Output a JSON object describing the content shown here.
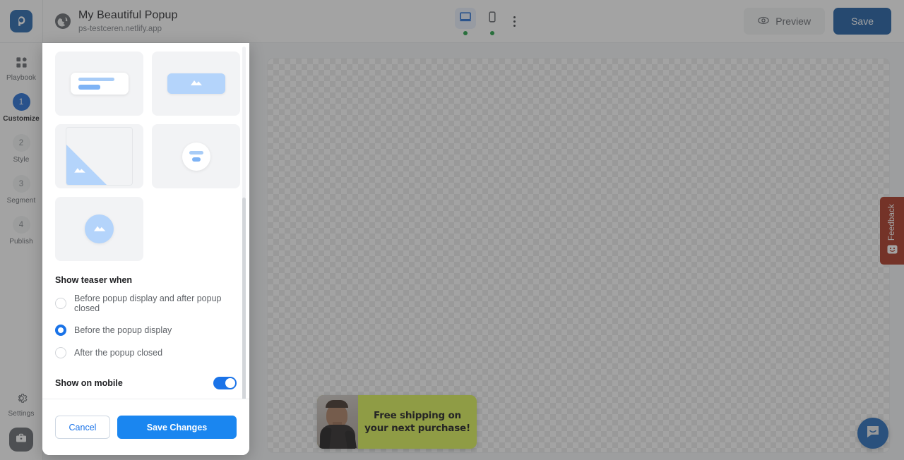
{
  "header": {
    "logo_icon": "popupsmart-logo-icon",
    "globe_icon": "globe-icon",
    "site_title": "My Beautiful Popup",
    "site_url": "ps-testceren.netlify.app",
    "desktop_icon": "desktop-monitor-icon",
    "mobile_icon": "mobile-phone-icon",
    "more_icon": "kebab-menu-icon",
    "preview_label": "Preview",
    "preview_icon": "eye-icon",
    "save_label": "Save",
    "accent_blue": "#14569f"
  },
  "sidebar": {
    "items": [
      {
        "label": "Playbook",
        "num": "",
        "icon": "grid-dashboard-icon",
        "active": false
      },
      {
        "label": "Customize",
        "num": "1",
        "icon": "",
        "active": true
      },
      {
        "label": "Style",
        "num": "2",
        "icon": "",
        "active": false
      },
      {
        "label": "Segment",
        "num": "3",
        "icon": "",
        "active": false
      },
      {
        "label": "Publish",
        "num": "4",
        "icon": "",
        "active": false
      }
    ],
    "settings_label": "Settings",
    "settings_icon": "gear-icon",
    "avatar_icon": "briefcase-icon"
  },
  "panel": {
    "templates": [
      {
        "variant": "cut-top-left",
        "name": "template-thumb-1"
      },
      {
        "variant": "cut-top-right",
        "name": "template-thumb-2"
      },
      {
        "variant": "card",
        "name": "template-thumb-3"
      },
      {
        "variant": "banner",
        "name": "template-thumb-4"
      },
      {
        "variant": "frame",
        "name": "template-thumb-5"
      },
      {
        "variant": "circle-white",
        "name": "template-thumb-6"
      },
      {
        "variant": "circle-blue",
        "name": "template-thumb-7"
      }
    ],
    "teaser_section_title": "Show teaser when",
    "radio_options": [
      {
        "label": "Before popup display and after popup closed",
        "selected": false
      },
      {
        "label": "Before the popup display",
        "selected": true
      },
      {
        "label": "After the popup closed",
        "selected": false
      }
    ],
    "mobile_toggle_label": "Show on mobile",
    "mobile_toggle_on": true,
    "cancel_label": "Cancel",
    "save_changes_label": "Save Changes",
    "selected_color": "#1a73e8"
  },
  "canvas": {
    "teaser": {
      "message": "Free shipping on your next purchase!",
      "background_color": "#d9f24f",
      "image_alt": "fashion-model-photo"
    }
  },
  "widgets": {
    "feedback_label": "Feedback",
    "feedback_icon": "smiley-face-icon",
    "feedback_color": "#a62c18",
    "chat_icon": "chat-bubble-icon",
    "chat_color": "#1c64b8"
  }
}
